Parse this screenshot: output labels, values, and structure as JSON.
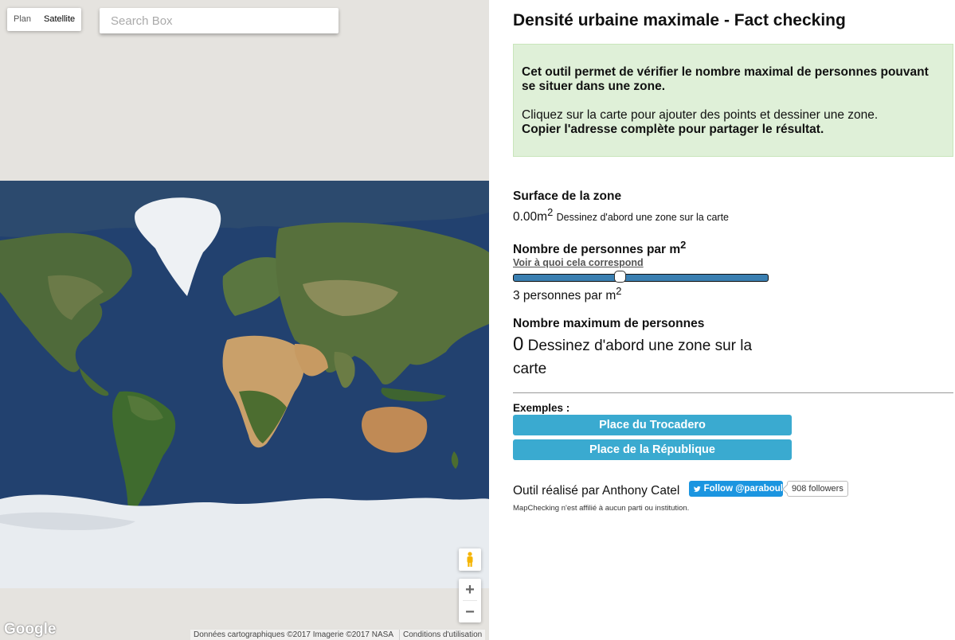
{
  "map": {
    "maptype_plan": "Plan",
    "maptype_satellite": "Satellite",
    "search_placeholder": "Search Box",
    "google_logo": "Google",
    "attribution": "Données cartographiques ©2017 Imagerie ©2017 NASA",
    "terms": "Conditions d'utilisation",
    "icons": [
      "pegman-icon",
      "zoom-in-icon",
      "zoom-out-icon"
    ],
    "colors": {
      "ocean": "#22416f",
      "ice": "#e8ecf0",
      "land": "#4f6a3a",
      "desert": "#c9a06a",
      "background": "#e5e3df"
    }
  },
  "panel": {
    "title": "Densité urbaine maximale - Fact checking",
    "info": {
      "intro": "Cet outil permet de vérifier le nombre maximal de personnes pouvant se situer dans une zone.",
      "howto": "Cliquez sur la carte pour ajouter des points et dessiner une zone.",
      "share": "Copier l'adresse complète pour partager le résultat."
    },
    "surface": {
      "label": "Surface de la zone",
      "value": "0.00m",
      "unit_sup": "2",
      "hint": "Dessinez d'abord une zone sur la carte"
    },
    "density": {
      "label": "Nombre de personnes par m",
      "label_sup": "2",
      "link": "Voir à quoi cela correspond",
      "slider_fraction": 0.42,
      "value": "3 personnes par m",
      "value_sup": "2"
    },
    "maximum": {
      "label": "Nombre maximum de personnes",
      "value": "0",
      "hint": "Dessinez d'abord une zone sur la carte"
    },
    "examples": {
      "label": "Exemples :",
      "items": [
        "Place du Trocadero",
        "Place de la République"
      ]
    },
    "credit": "Outil réalisé par Anthony Catel",
    "twitter": {
      "follow": "Follow @paraboul",
      "count": "908 followers"
    },
    "disclaimer": "MapChecking n'est affilié à aucun parti ou institution.",
    "colors": {
      "info_bg": "#dff0d8",
      "button": "#3aaad0",
      "slider": "#3a7fb1",
      "twitter": "#1b95e0"
    }
  }
}
